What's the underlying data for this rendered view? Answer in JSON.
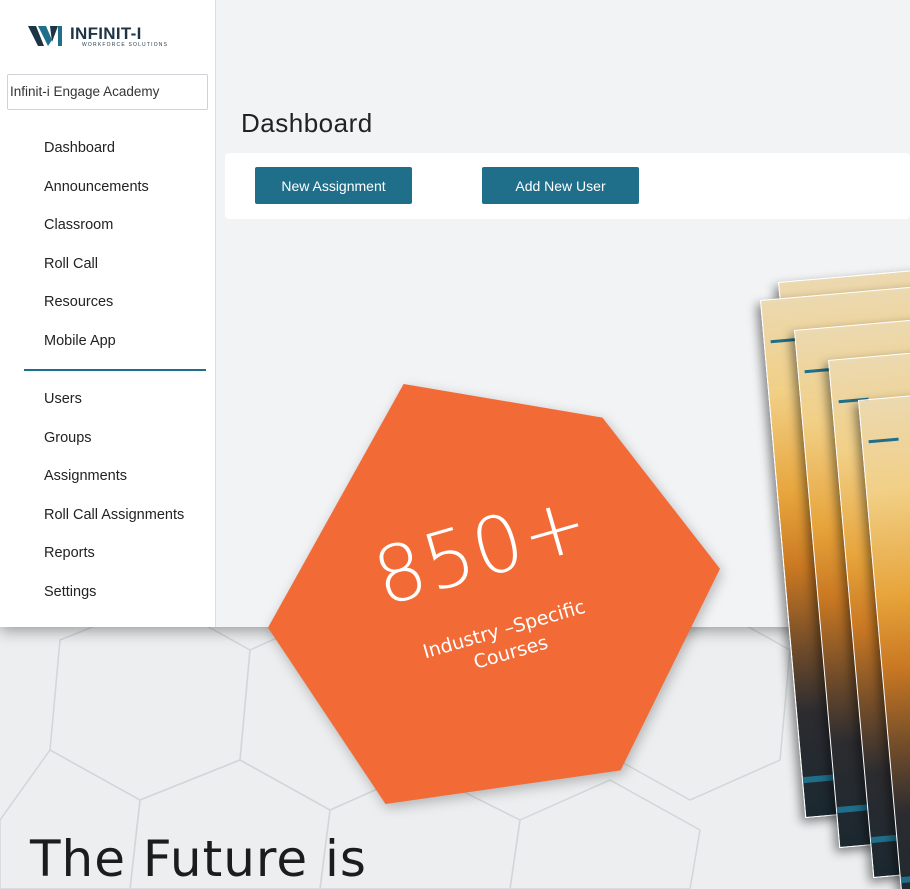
{
  "logo": {
    "name": "INFINIT-I",
    "subtitle": "WORKFORCE SOLUTIONS",
    "brand_color": "#1f6f8b"
  },
  "academy_select": {
    "value": "Infinit-i Engage Academy"
  },
  "sidebar": {
    "primary_items": [
      {
        "label": "Dashboard"
      },
      {
        "label": "Announcements"
      },
      {
        "label": "Classroom"
      },
      {
        "label": "Roll Call"
      },
      {
        "label": "Resources"
      },
      {
        "label": "Mobile App"
      }
    ],
    "admin_items": [
      {
        "label": "Users"
      },
      {
        "label": "Groups"
      },
      {
        "label": "Assignments"
      },
      {
        "label": "Roll Call Assignments"
      },
      {
        "label": "Reports"
      },
      {
        "label": "Settings"
      }
    ]
  },
  "main": {
    "title": "Dashboard",
    "buttons": {
      "new_assignment": "New Assignment",
      "add_new_user": "Add New User"
    }
  },
  "badge": {
    "number": "850+",
    "caption_line1": "Industry –Specific",
    "caption_line2": "Courses",
    "color": "#f26a35"
  },
  "headline": "The Future is",
  "colors": {
    "accent": "#1f6f8b",
    "badge": "#f26a35"
  }
}
